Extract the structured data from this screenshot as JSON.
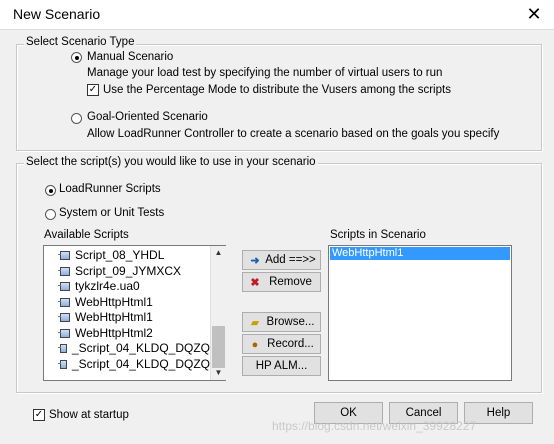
{
  "window": {
    "title": "New Scenario",
    "close_glyph": "✕"
  },
  "scenario_type": {
    "legend": "Select Scenario Type",
    "manual": {
      "label": "Manual Scenario",
      "selected": true,
      "description": "Manage your load test by specifying the number of virtual users to run",
      "percentage_mode": {
        "label": "Use the Percentage Mode to distribute the Vusers among the scripts",
        "checked": true
      }
    },
    "goal": {
      "label": "Goal-Oriented Scenario",
      "selected": false,
      "description": "Allow LoadRunner Controller to create a scenario based on the goals you specify"
    }
  },
  "scripts": {
    "legend": "Select the script(s) you would like to use in your scenario",
    "loadrunner": {
      "label": "LoadRunner Scripts",
      "selected": true
    },
    "system_unit": {
      "label": "System or Unit Tests",
      "selected": false
    },
    "available_label": "Available Scripts",
    "available": [
      "Script_08_YHDL",
      "Script_09_JYMXCX",
      "tykzlr4e.ua0",
      "WebHttpHtml1",
      "WebHttpHtml1",
      "WebHttpHtml2",
      "_Script_04_KLDQ_DQZQ",
      "_Script_04_KLDQ_DQZQ"
    ],
    "in_scenario_label": "Scripts in Scenario",
    "in_scenario": [
      "WebHttpHtml1"
    ],
    "buttons": {
      "add": "Add ==>>",
      "remove": "Remove",
      "browse": "Browse...",
      "record": "Record...",
      "hp_alm": "HP ALM..."
    }
  },
  "footer": {
    "show_at_startup": {
      "label": "Show at startup",
      "checked": true
    },
    "ok": "OK",
    "cancel": "Cancel",
    "help": "Help",
    "watermark": "https://blog.csdn.net/weixin_39928227"
  },
  "colors": {
    "selection": "#3399ff",
    "dialog_bg": "#f0f0f0"
  }
}
